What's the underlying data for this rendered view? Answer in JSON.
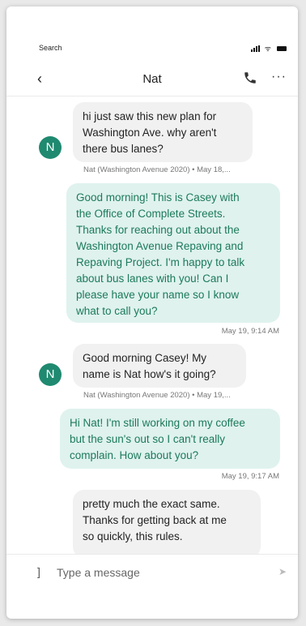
{
  "status_bar": {
    "back_app_label": "Search"
  },
  "header": {
    "title": "Nat",
    "back_glyph": "‹",
    "more_glyph": "···"
  },
  "messages": [
    {
      "direction": "in",
      "text": "hi just saw this new plan for\nWashington Ave.  why aren't\nthere bus lanes?",
      "meta": "Nat (Washington Avenue 2020) • May 18,...",
      "avatar": "N"
    },
    {
      "direction": "out",
      "text": "Good morning! This is Casey with\nthe Office of Complete Streets.\nThanks for reaching out about the\nWashington Avenue Repaving and\nRepaving Project. I'm happy to talk\nabout bus lanes with you! Can I\nplease have your name so I know\nwhat to call you?",
      "meta": "May 19, 9:14 AM"
    },
    {
      "direction": "in",
      "text": "Good morning Casey!  My\nname is Nat how's it going?",
      "meta": "Nat (Washington Avenue 2020) • May 19,...",
      "avatar": "N"
    },
    {
      "direction": "out",
      "text": "Hi Nat! I'm still working on my coffee\nbut the sun's out so I can't really\ncomplain. How about you?",
      "meta": "May 19, 9:17 AM"
    },
    {
      "direction": "in",
      "text": "pretty much the exact same.\nThanks for getting back at me\nso quickly, this rules.",
      "meta": ""
    }
  ],
  "composer": {
    "placeholder": "Type a message"
  },
  "colors": {
    "avatar": "#1f8a70",
    "out_bubble_bg": "#dff2ee",
    "out_text": "#1c7a5a",
    "in_bubble_bg": "#f1f1f1"
  },
  "icons": {
    "back": "chevron-left-icon",
    "call": "phone-icon",
    "more": "more-dots-icon",
    "attach": "attach-icon",
    "send": "send-icon"
  }
}
